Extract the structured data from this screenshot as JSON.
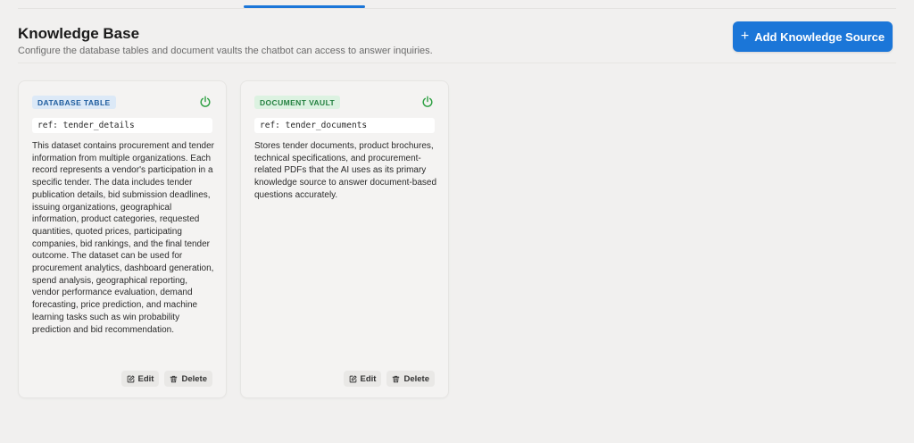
{
  "header": {
    "title": "Knowledge Base",
    "subtitle": "Configure the database tables and document vaults the chatbot can access to answer inquiries.",
    "add_button_label": "Add Knowledge Source",
    "add_button_icon": "plus-icon"
  },
  "colors": {
    "accent": "#1b76d8",
    "database_badge_bg": "#dce9f7",
    "database_badge_text": "#1f5d9e",
    "vault_badge_bg": "#dcf2e1",
    "vault_badge_text": "#23803f",
    "power_on": "#2ea043"
  },
  "sources": [
    {
      "type_label": "DATABASE TABLE",
      "ref": "ref: tender_details",
      "enabled": true,
      "description": "This dataset contains procurement and tender information from multiple organizations. Each record represents a vendor's participation in a specific tender. The data includes tender publication details, bid submission deadlines, issuing organizations, geographical information, product categories, requested quantities, quoted prices, participating companies, bid rankings, and the final tender outcome. The dataset can be used for procurement analytics, dashboard generation, spend analysis, geographical reporting, vendor performance evaluation, demand forecasting, price prediction, and machine learning tasks such as win probability prediction and bid recommendation.",
      "edit_label": "Edit",
      "delete_label": "Delete"
    },
    {
      "type_label": "DOCUMENT VAULT",
      "ref": "ref: tender_documents",
      "enabled": true,
      "description": "Stores tender documents, product brochures, technical specifications, and procurement-related PDFs that the AI uses as its primary knowledge source to answer document-based questions accurately.",
      "edit_label": "Edit",
      "delete_label": "Delete"
    }
  ]
}
